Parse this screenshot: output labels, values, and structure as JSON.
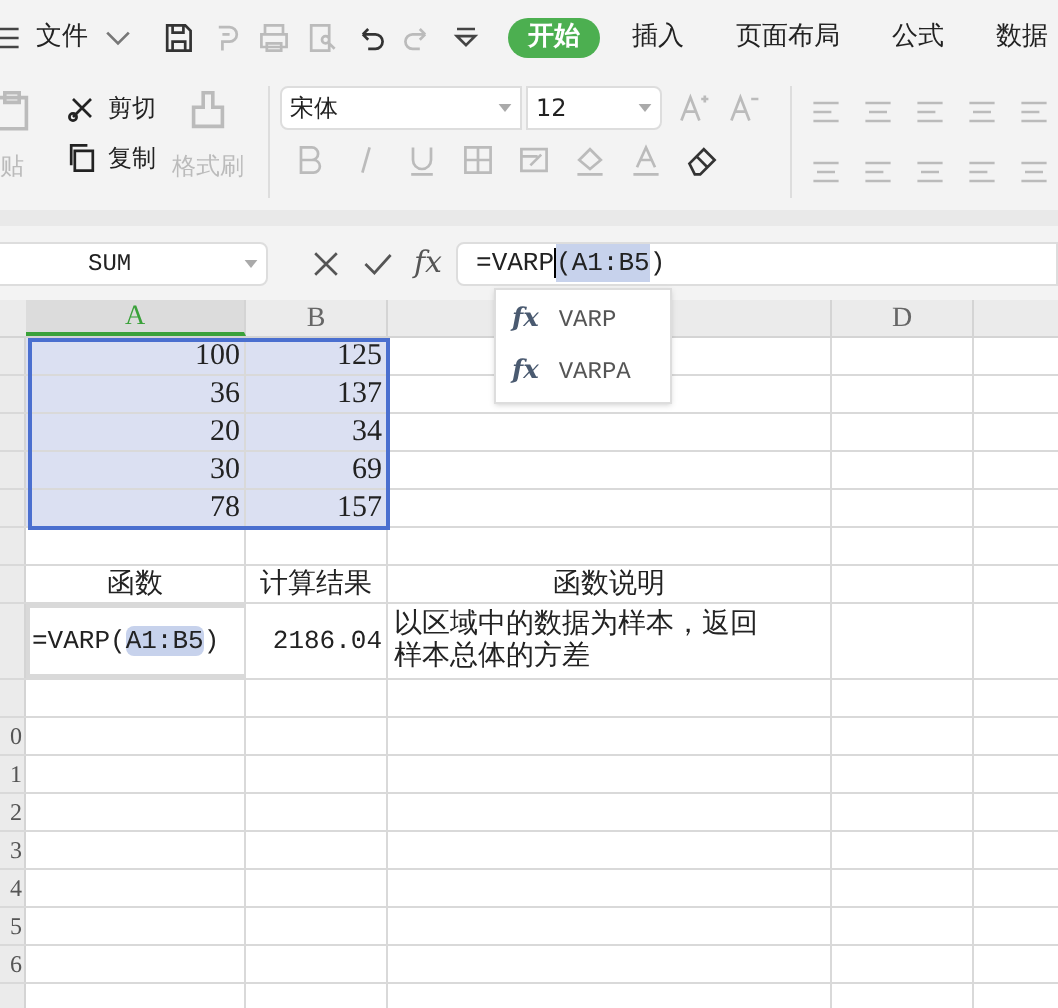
{
  "menu": {
    "label": "文件"
  },
  "tabs": [
    {
      "label": "开始",
      "selected": true
    },
    {
      "label": "插入",
      "selected": false
    },
    {
      "label": "页面布局",
      "selected": false
    },
    {
      "label": "公式",
      "selected": false
    },
    {
      "label": "数据",
      "selected": false
    }
  ],
  "ribbon": {
    "paste": "贴",
    "cut": "剪切",
    "copy": "复制",
    "format_painter": "格式刷",
    "font": "宋体",
    "size": "12"
  },
  "formula_bar": {
    "name_box": "SUM",
    "fx": "fx",
    "formula_prefix": "=VARP",
    "formula_reference": "(A1:B5",
    "formula_suffix": ")"
  },
  "autocomplete": [
    {
      "icon": "fx",
      "name": "VARP"
    },
    {
      "icon": "fx",
      "name": "VARPA"
    }
  ],
  "columns": [
    {
      "label": "A",
      "selected": true
    },
    {
      "label": "B",
      "selected": false
    },
    {},
    {
      "label": "D",
      "selected": false
    },
    {}
  ],
  "rows": [
    {
      "cells": [
        "100",
        "125"
      ]
    },
    {
      "cells": [
        "36",
        "137"
      ]
    },
    {
      "cells": [
        "20",
        "34"
      ]
    },
    {
      "cells": [
        "30",
        "69"
      ]
    },
    {
      "cells": [
        "78",
        "157"
      ]
    },
    {
      "cells": []
    },
    {
      "cells": [
        "函数",
        "计算结果",
        "函数说明"
      ]
    },
    {
      "kind": "formula",
      "cells": [
        "=VARP(",
        "A1:B5",
        ")",
        "2186.04",
        "以区域中的数据为样本，返回样本总体的方差"
      ]
    },
    {
      "cells": []
    },
    {
      "number": "0",
      "cells": []
    },
    {
      "number": "1",
      "cells": []
    },
    {
      "number": "2",
      "cells": []
    },
    {
      "number": "3",
      "cells": []
    },
    {
      "number": "4",
      "cells": []
    },
    {
      "number": "5",
      "cells": []
    },
    {
      "number": "6",
      "cells": []
    },
    {
      "cells": []
    }
  ]
}
